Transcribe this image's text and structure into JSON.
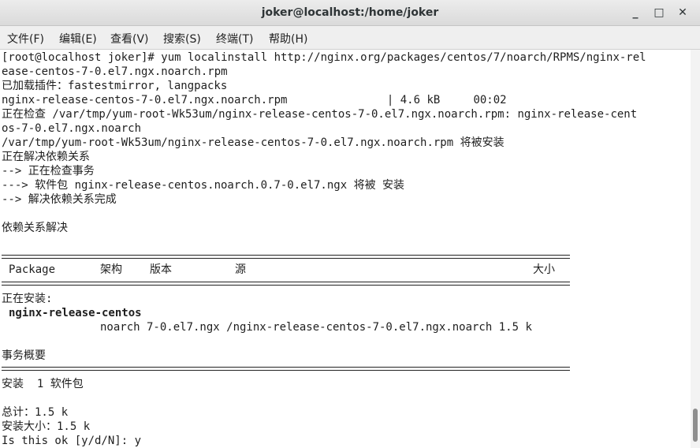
{
  "window": {
    "title": "joker@localhost:/home/joker",
    "minimize_glyph": "_",
    "maximize_glyph": "□",
    "close_glyph": "✕"
  },
  "menu": [
    "文件(F)",
    "编辑(E)",
    "查看(V)",
    "搜索(S)",
    "终端(T)",
    "帮助(H)"
  ],
  "terminal": {
    "lines": [
      "[root@localhost joker]# yum localinstall http://nginx.org/packages/centos/7/noarch/RPMS/nginx-rel",
      "ease-centos-7-0.el7.ngx.noarch.rpm",
      "已加载插件：fastestmirror, langpacks",
      "nginx-release-centos-7-0.el7.ngx.noarch.rpm               | 4.6 kB     00:02",
      "正在检查 /var/tmp/yum-root-Wk53um/nginx-release-centos-7-0.el7.ngx.noarch.rpm: nginx-release-cent",
      "os-7-0.el7.ngx.noarch",
      "/var/tmp/yum-root-Wk53um/nginx-release-centos-7-0.el7.ngx.noarch.rpm 将被安装",
      "正在解决依赖关系",
      "--> 正在检查事务",
      "---> 软件包 nginx-release-centos.noarch.0.7-0.el7.ngx 将被 安装",
      "--> 解决依赖关系完成",
      "",
      "依赖关系解决"
    ],
    "table_header": {
      "package": "Package",
      "arch": "架构",
      "version": "版本",
      "repo": "源",
      "size": "大小"
    },
    "installing_label": "正在安装:",
    "package_name": "nginx-release-centos",
    "package_detail": "noarch 7-0.el7.ngx /nginx-release-centos-7-0.el7.ngx.noarch 1.5 k",
    "summary_label": "事务概要",
    "install_count": "安装  1 软件包",
    "total": "总计：1.5 k",
    "install_size": "安装大小：1.5 k",
    "prompt": "Is this ok [y/d/N]: y"
  }
}
